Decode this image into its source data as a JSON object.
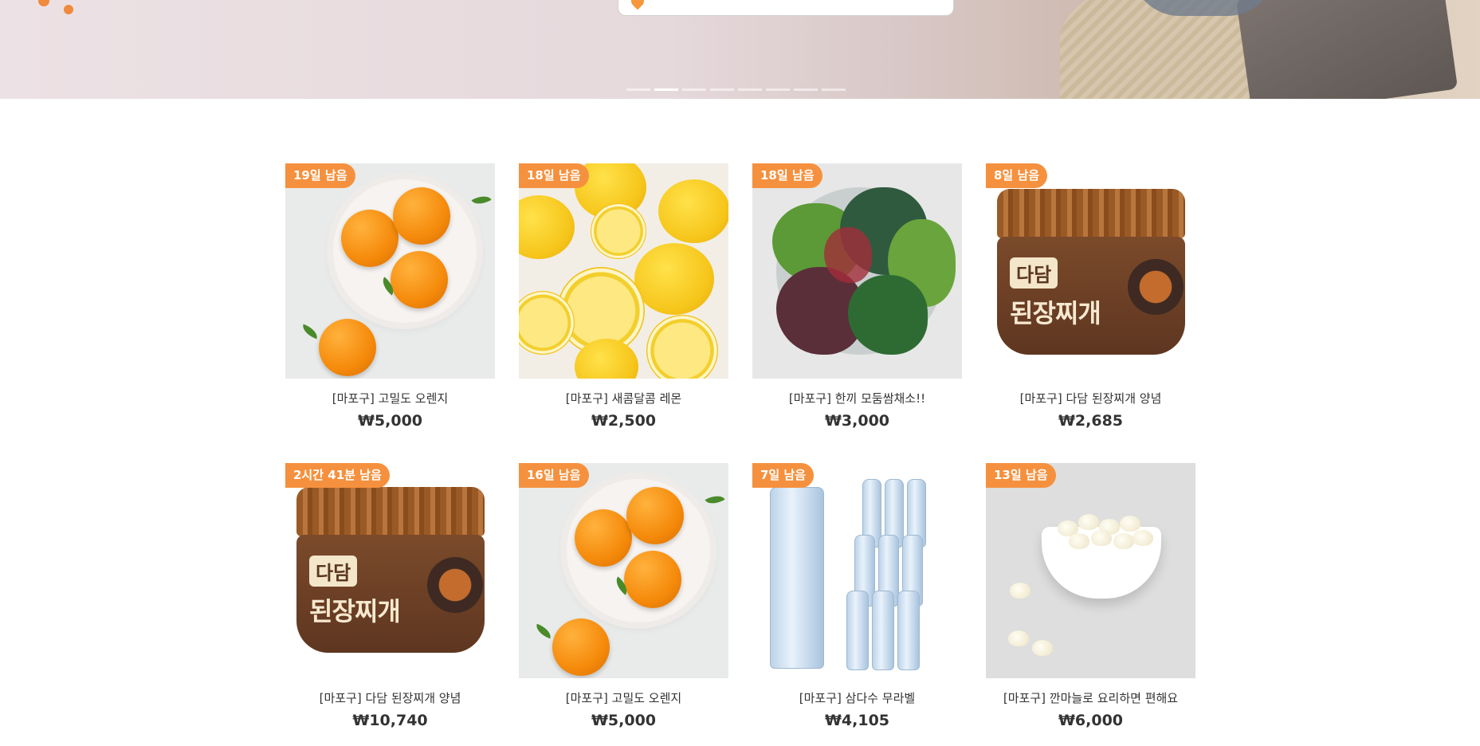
{
  "hero": {
    "search_placeholder": "",
    "indicator_count": 8,
    "active_indicator": 1
  },
  "products": [
    {
      "badge": "19일 남음",
      "name": "[마포구] 고밀도 오렌지",
      "price": "₩5,000",
      "image": "oranges"
    },
    {
      "badge": "18일 남음",
      "name": "[마포구] 새콤달콤 레몬",
      "price": "₩2,500",
      "image": "lemons"
    },
    {
      "badge": "18일 남음",
      "name": "[마포구] 한끼 모둠쌈채소!!",
      "price": "₩3,000",
      "image": "greens"
    },
    {
      "badge": "8일 남음",
      "name": "[마포구] 다담 된장찌개 양념",
      "price": "₩2,685",
      "image": "doenjang-jar"
    },
    {
      "badge": "2시간 41분 남음",
      "name": "[마포구] 다담 된장찌개 양념",
      "price": "₩10,740",
      "image": "doenjang-jar"
    },
    {
      "badge": "16일 남음",
      "name": "[마포구] 고밀도 오렌지",
      "price": "₩5,000",
      "image": "oranges"
    },
    {
      "badge": "7일 남음",
      "name": "[마포구] 삼다수 무라벨",
      "price": "₩4,105",
      "image": "water-bottles"
    },
    {
      "badge": "13일 남음",
      "name": "[마포구] 깐마늘로 요리하면 편해요",
      "price": "₩6,000",
      "image": "garlic"
    }
  ],
  "jar": {
    "brand": "다담",
    "title": "된장찌개"
  },
  "colors": {
    "badge": "#f5913e",
    "accent": "#f7963a"
  }
}
